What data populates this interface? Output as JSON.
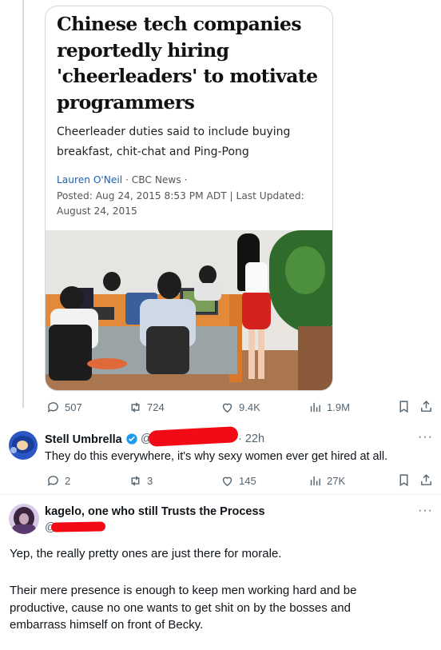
{
  "article": {
    "headline": "Chinese tech companies reportedly hiring 'cheerleaders' to motivate programmers",
    "dek": "Cheerleader duties said to include buying breakfast, chit-chat and Ping-Pong",
    "author": "Lauren O'Neil",
    "source": " · CBC News ·",
    "dates": "Posted: Aug 24, 2015 8:53 PM ADT | Last Updated: August 24, 2015"
  },
  "post1": {
    "replies": "507",
    "reposts": "724",
    "likes": "9.4K",
    "views": "1.9M"
  },
  "reply1": {
    "name": "Stell Umbrella",
    "handle_prefix": "@",
    "time": "· 22h",
    "text": "They do this everywhere, it's why sexy women ever get hired at all.",
    "replies": "2",
    "reposts": "3",
    "likes": "145",
    "views": "27K"
  },
  "reply2": {
    "name": "kagelo, one who still Trusts the Process",
    "handle_prefix": "@",
    "para1": "Yep, the really pretty ones are just there for morale.",
    "para2": "Their mere presence is enough to keep men working hard and be productive, cause no one wants to get shit on by the bosses and embarrass himself on front of Becky."
  },
  "icons": {
    "reply": "speech-bubble-icon",
    "repost": "repost-arrows-icon",
    "like": "heart-icon",
    "views": "bar-chart-icon",
    "bookmark": "bookmark-icon",
    "share": "share-upload-icon",
    "more": "more-dots-icon",
    "verified": "verified-badge-icon"
  },
  "colors": {
    "accent": "#1d9bf0",
    "muted": "#536471",
    "redaction": "#f20b16",
    "author_link": "#1a5fb4"
  }
}
